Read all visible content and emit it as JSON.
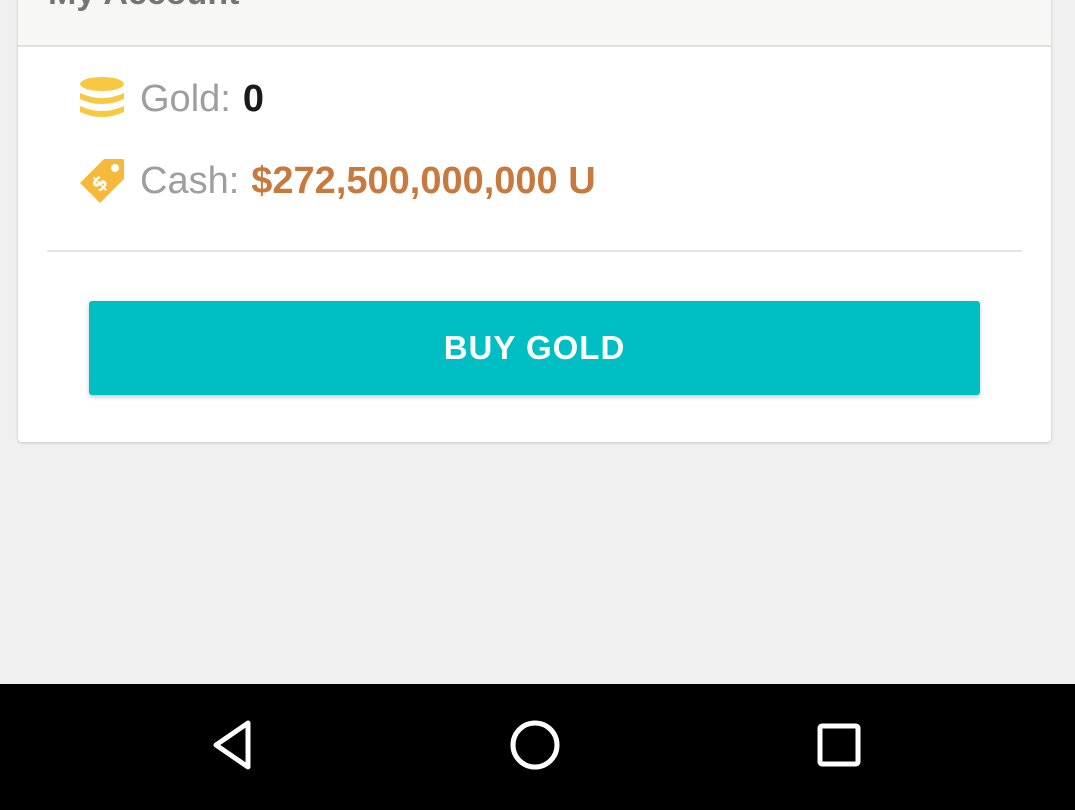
{
  "account": {
    "title": "My Account"
  },
  "gold": {
    "label": "Gold:",
    "value": "0",
    "icon": "coin-stack-icon"
  },
  "cash": {
    "label": "Cash:",
    "value": "$272,500,000,000 U",
    "icon": "price-tag-icon"
  },
  "actions": {
    "buy_gold_label": "BUY GOLD"
  },
  "navbar": {
    "back_icon": "back-triangle-icon",
    "home_icon": "home-circle-icon",
    "recents_icon": "recents-square-icon"
  },
  "colors": {
    "accent": "#00bfc4",
    "cash_value": "#c87a3e",
    "gold_icon": "#f8c842",
    "tag_icon": "#f6b93b",
    "navbar": "#000000",
    "background": "#f0f0f0"
  }
}
